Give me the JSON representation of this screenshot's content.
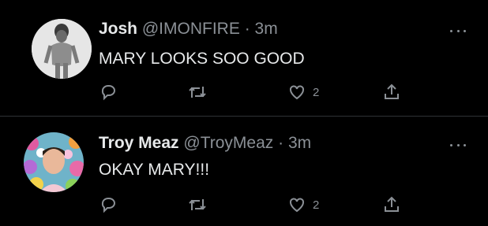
{
  "tweets": [
    {
      "name": "Josh",
      "handle": "@IMONFIRE",
      "separator": "·",
      "time": "3m",
      "text": "MARY LOOKS SOO GOOD",
      "like_count": "2"
    },
    {
      "name": "Troy Meaz",
      "handle": "@TroyMeaz",
      "separator": "·",
      "time": "3m",
      "text": "OKAY MARY!!!",
      "like_count": "2"
    }
  ],
  "icons": {
    "reply": "reply-icon",
    "retweet": "retweet-icon",
    "like": "heart-icon",
    "share": "share-icon",
    "more": "more-icon"
  },
  "colors": {
    "background": "#000000",
    "text": "#e7e9ea",
    "muted": "#8b9096",
    "divider": "#2f3336"
  }
}
